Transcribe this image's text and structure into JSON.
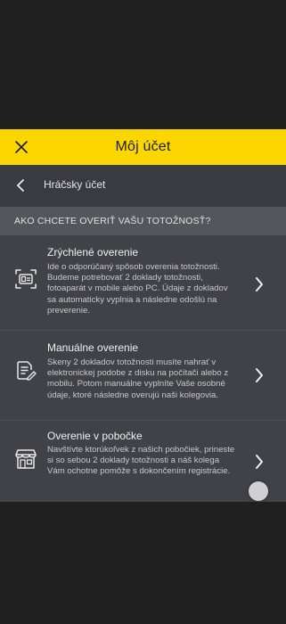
{
  "header": {
    "title": "Môj účet",
    "close_icon": "close-icon",
    "background": "#fbd600"
  },
  "subheader": {
    "title": "Hráčsky účet",
    "back_icon": "chevron-left-icon"
  },
  "section": {
    "title": "AKO CHCETE OVERIŤ VAŠU TOTOŽNOSŤ?"
  },
  "options": [
    {
      "icon": "id-card-icon",
      "title": "Zrýchlené overenie",
      "description": "Ide o odporúčaný spôsob overenia totožnosti. Budeme potrebovať 2 doklady totožnosti, fotoaparát v mobile alebo PC. Údaje z dokladov sa automaticky vyplnia a následne odošlú na preverenie."
    },
    {
      "icon": "document-edit-icon",
      "title": "Manuálne overenie",
      "description": "Skeny 2 dokladov totožnosti musíte nahrať v elektronickej podobe z disku na počítači alebo z mobilu. Potom manuálne vyplníte Vaše osobné údaje, ktoré následne overujú naši kolegovia."
    },
    {
      "icon": "store-icon",
      "title": "Overenie v pobočke",
      "description": "Navštívte ktorúkoľvek z našich pobočiek, prineste si so sebou 2 doklady totožnosti a náš kolega Vám ochotne pomôže s dokončením registrácie."
    }
  ]
}
